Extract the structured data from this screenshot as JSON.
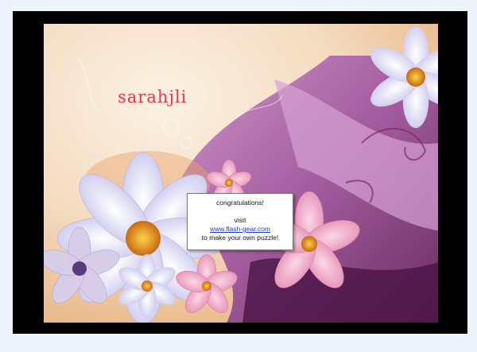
{
  "puzzle": {
    "signature": "sarahjli"
  },
  "dialog": {
    "title": "congratulations!",
    "visit_label": "visit",
    "link_text": "www.flash-gear.com",
    "footer": "to make your own puzzle!"
  },
  "colors": {
    "frame": "#000000",
    "page_background": "#eef4fc",
    "signature": "#ee3344",
    "link": "#1a3ccc"
  }
}
